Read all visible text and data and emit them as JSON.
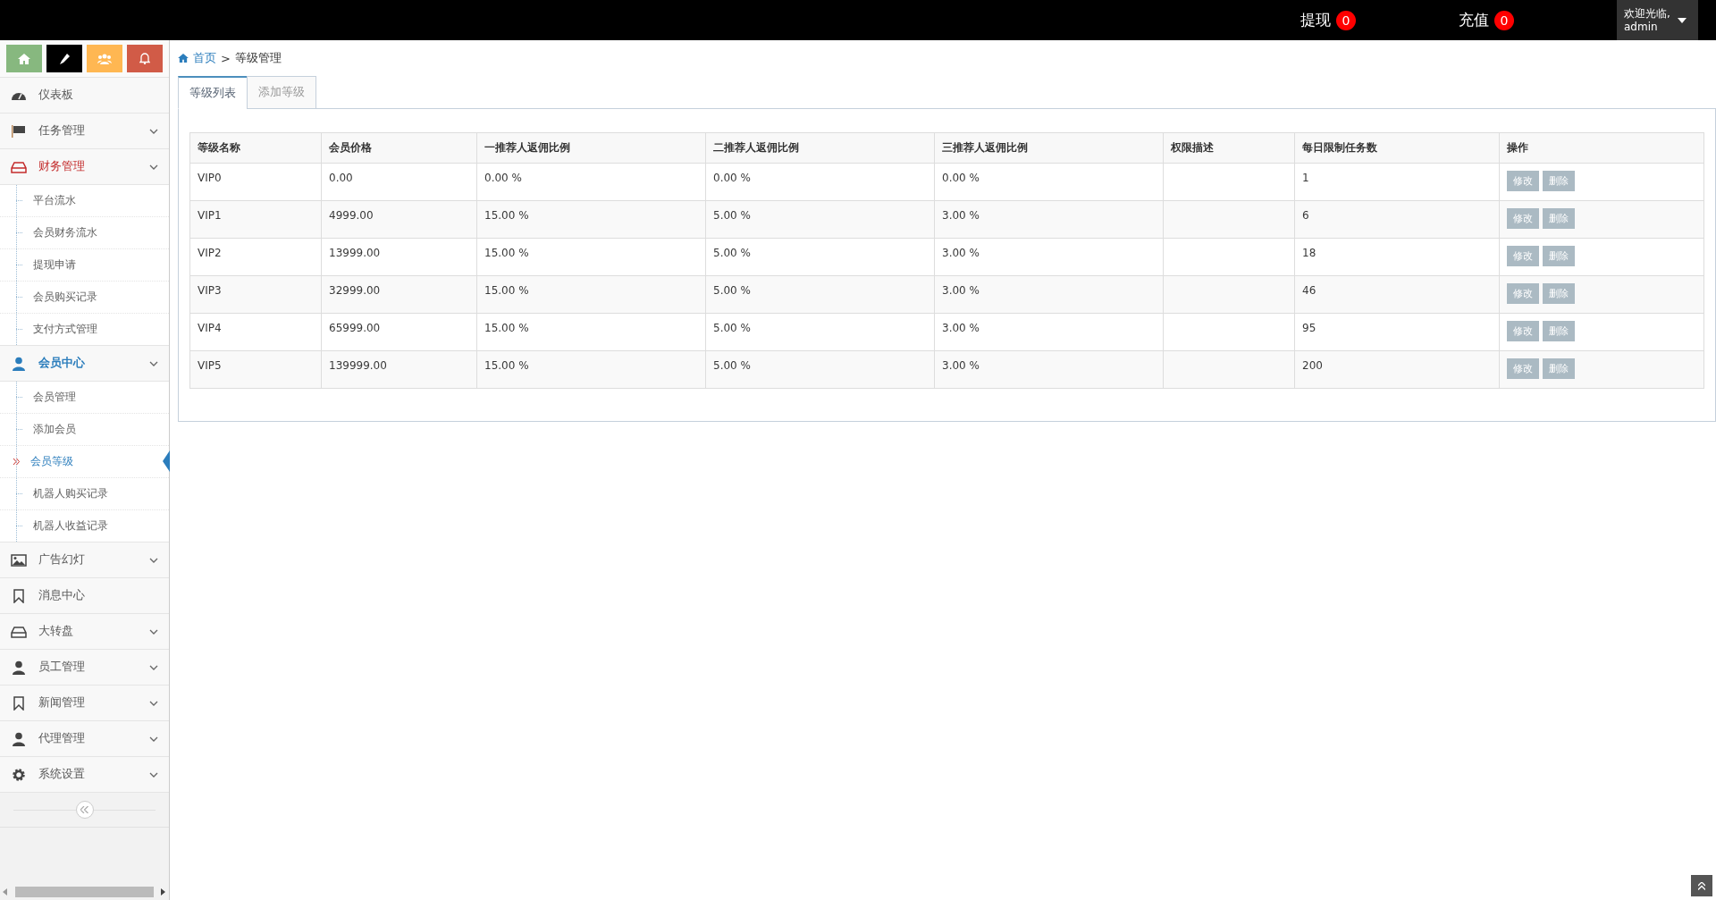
{
  "topbar": {
    "counters": [
      {
        "label": "提现",
        "count": "0"
      },
      {
        "label": "充值",
        "count": "0"
      }
    ],
    "user": {
      "greeting": "欢迎光临,",
      "name": "admin"
    }
  },
  "sidebar": {
    "menu": [
      {
        "label": "仪表板",
        "expandable": false,
        "selected": false,
        "hovered": false
      },
      {
        "label": "任务管理",
        "expandable": true,
        "selected": false,
        "hovered": false
      },
      {
        "label": "财务管理",
        "expandable": true,
        "selected": false,
        "hovered": true,
        "children": [
          {
            "label": "平台流水",
            "selected": false
          },
          {
            "label": "会员财务流水",
            "selected": false
          },
          {
            "label": "提现申请",
            "selected": false
          },
          {
            "label": "会员购买记录",
            "selected": false
          },
          {
            "label": "支付方式管理",
            "selected": false
          }
        ]
      },
      {
        "label": "会员中心",
        "expandable": true,
        "selected": true,
        "hovered": false,
        "children": [
          {
            "label": "会员管理",
            "selected": false
          },
          {
            "label": "添加会员",
            "selected": false
          },
          {
            "label": "会员等级",
            "selected": true
          },
          {
            "label": "机器人购买记录",
            "selected": false
          },
          {
            "label": "机器人收益记录",
            "selected": false
          }
        ]
      },
      {
        "label": "广告幻灯",
        "expandable": true,
        "selected": false,
        "hovered": false
      },
      {
        "label": "消息中心",
        "expandable": false,
        "selected": false,
        "hovered": false
      },
      {
        "label": "大转盘",
        "expandable": true,
        "selected": false,
        "hovered": false
      },
      {
        "label": "员工管理",
        "expandable": true,
        "selected": false,
        "hovered": false
      },
      {
        "label": "新闻管理",
        "expandable": true,
        "selected": false,
        "hovered": false
      },
      {
        "label": "代理管理",
        "expandable": true,
        "selected": false,
        "hovered": false
      },
      {
        "label": "系统设置",
        "expandable": true,
        "selected": false,
        "hovered": false
      }
    ]
  },
  "breadcrumb": {
    "home": "首页",
    "separator": ">",
    "current": "等级管理"
  },
  "tabs": [
    {
      "label": "等级列表",
      "selected": true
    },
    {
      "label": "添加等级",
      "selected": false
    }
  ],
  "table": {
    "columns": [
      "等级名称",
      "会员价格",
      "一推荐人返佣比例",
      "二推荐人返佣比例",
      "三推荐人返佣比例",
      "权限描述",
      "每日限制任务数",
      "操作"
    ],
    "rows": [
      {
        "cells": [
          "VIP0",
          "0.00",
          "0.00 %",
          "0.00 %",
          "0.00 %",
          "",
          "1"
        ],
        "actions": [
          "修改",
          "删除"
        ]
      },
      {
        "cells": [
          "VIP1",
          "4999.00",
          "15.00 %",
          "5.00 %",
          "3.00 %",
          "",
          "6"
        ],
        "actions": [
          "修改",
          "删除"
        ]
      },
      {
        "cells": [
          "VIP2",
          "13999.00",
          "15.00 %",
          "5.00 %",
          "3.00 %",
          "",
          "18"
        ],
        "actions": [
          "修改",
          "删除"
        ]
      },
      {
        "cells": [
          "VIP3",
          "32999.00",
          "15.00 %",
          "5.00 %",
          "3.00 %",
          "",
          "46"
        ],
        "actions": [
          "修改",
          "删除"
        ]
      },
      {
        "cells": [
          "VIP4",
          "65999.00",
          "15.00 %",
          "5.00 %",
          "3.00 %",
          "",
          "95"
        ],
        "actions": [
          "修改",
          "删除"
        ]
      },
      {
        "cells": [
          "VIP5",
          "139999.00",
          "15.00 %",
          "5.00 %",
          "3.00 %",
          "",
          "200"
        ],
        "actions": [
          "修改",
          "删除"
        ]
      }
    ]
  }
}
